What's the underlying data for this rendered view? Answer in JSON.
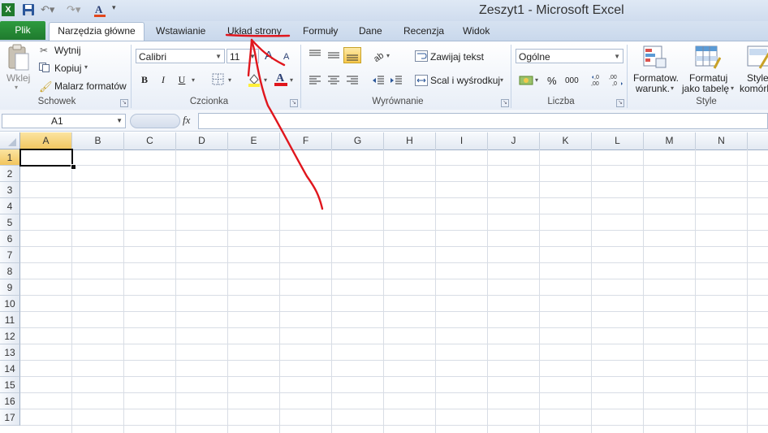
{
  "window": {
    "title": "Zeszyt1  -  Microsoft Excel"
  },
  "tabs": [
    {
      "label": "Plik"
    },
    {
      "label": "Narzędzia główne"
    },
    {
      "label": "Wstawianie"
    },
    {
      "label": "Układ strony"
    },
    {
      "label": "Formuły"
    },
    {
      "label": "Dane"
    },
    {
      "label": "Recenzja"
    },
    {
      "label": "Widok"
    }
  ],
  "ribbon": {
    "clipboard": {
      "paste": "Wklej",
      "cut": "Wytnij",
      "copy": "Kopiuj",
      "format_painter": "Malarz formatów",
      "group": "Schowek"
    },
    "font": {
      "name": "Calibri",
      "size": "11",
      "bold": "B",
      "italic": "I",
      "underline": "U",
      "grow": "A",
      "shrink": "A",
      "color": "A",
      "group": "Czcionka"
    },
    "alignment": {
      "wrap": "Zawijaj tekst",
      "merge": "Scal i wyśrodkuj",
      "group": "Wyrównanie"
    },
    "number": {
      "format": "Ogólne",
      "percent": "%",
      "thousands": "000",
      "inc_dec": ",0\n,00",
      "dec_dec": ",00\n,0",
      "group": "Liczba"
    },
    "styles": {
      "cond_line1": "Formatow.",
      "cond_line2": "warunk.",
      "table_line1": "Formatuj",
      "table_line2": "jako tabelę",
      "cell_line1": "Style",
      "cell_line2": "komórki",
      "group": "Style"
    }
  },
  "formula_bar": {
    "name_box": "A1",
    "fx": "fx",
    "value": ""
  },
  "sheet": {
    "columns": [
      "A",
      "B",
      "C",
      "D",
      "E",
      "F",
      "G",
      "H",
      "I",
      "J",
      "K",
      "L",
      "M",
      "N"
    ],
    "rows": [
      "1",
      "2",
      "3",
      "4",
      "5",
      "6",
      "7",
      "8",
      "9",
      "10",
      "11",
      "12",
      "13",
      "14",
      "15",
      "16",
      "17"
    ],
    "active_cell": "A1"
  },
  "colors": {
    "file_tab": "#1f7a2e",
    "annotation": "#e0161d",
    "selection_header": "#f2c55e"
  },
  "annotation": {
    "target_tab": "Układ strony",
    "type": "red arrow and underline"
  }
}
